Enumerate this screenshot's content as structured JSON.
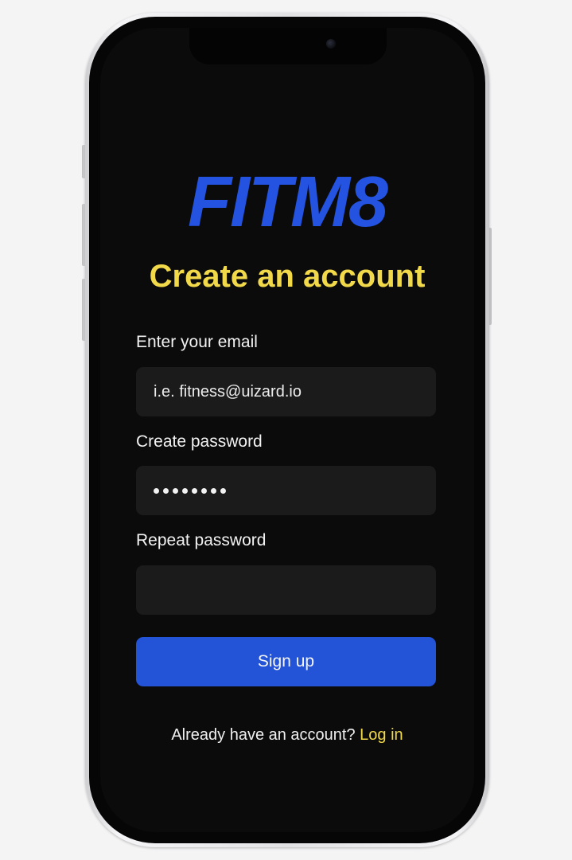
{
  "app": {
    "logo_text": "FITM8"
  },
  "signup": {
    "title": "Create an account",
    "email": {
      "label": "Enter your email",
      "placeholder": "i.e. fitness@uizard.io",
      "value": ""
    },
    "password": {
      "label": "Create password",
      "masked_length": 8
    },
    "repeat_password": {
      "label": "Repeat password",
      "value": ""
    },
    "submit_label": "Sign up",
    "footer": {
      "prompt": "Already have an account?",
      "link_label": "Log in"
    }
  },
  "colors": {
    "brand_blue": "#2353e0",
    "accent_yellow": "#f1d94a",
    "background": "#0b0b0b",
    "field_background": "#1b1b1c",
    "button_blue": "#2353d6"
  }
}
